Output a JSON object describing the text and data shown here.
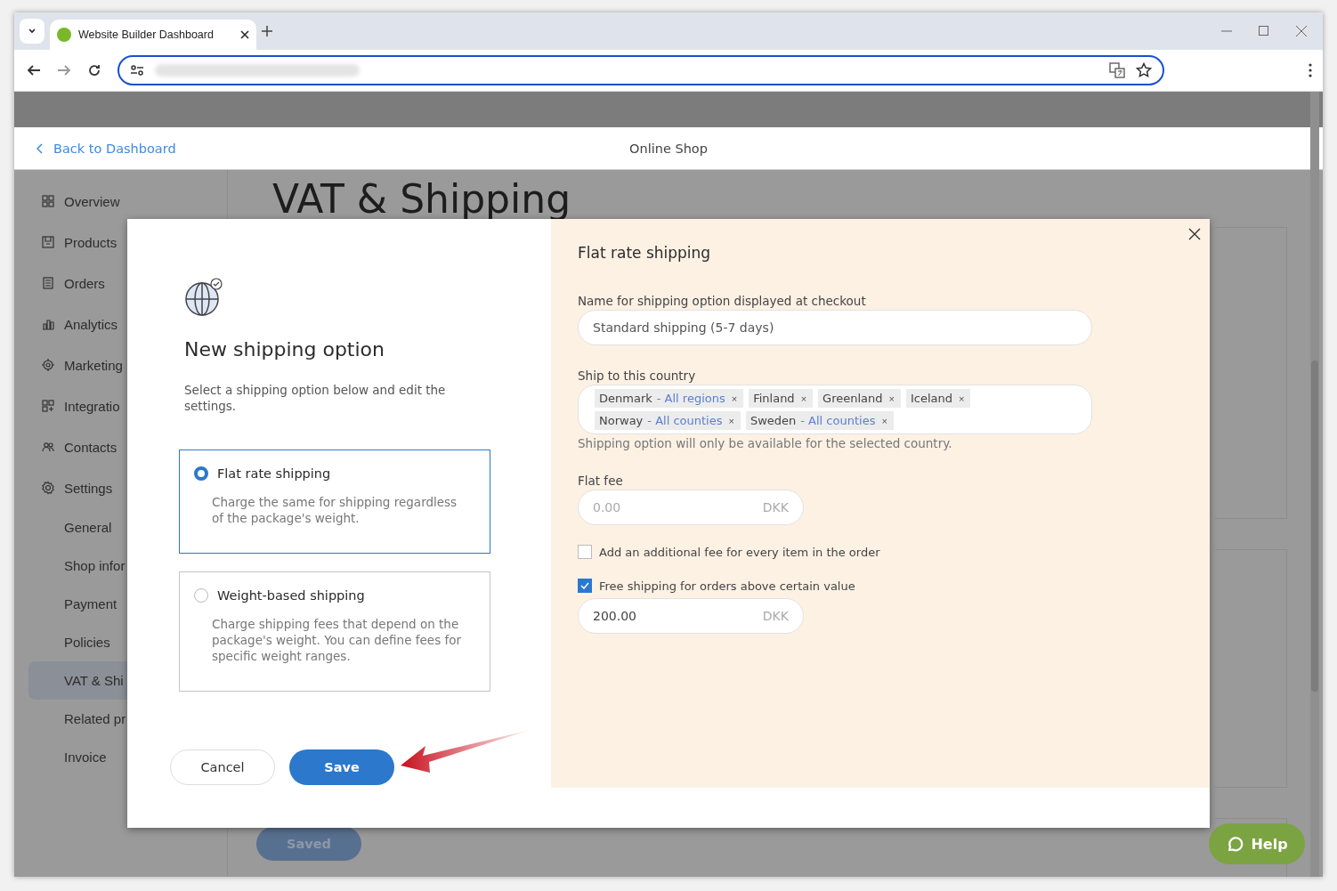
{
  "browser": {
    "tab_title": "Website Builder Dashboard"
  },
  "header": {
    "back_link": "Back to Dashboard",
    "title": "Online Shop"
  },
  "sidebar": {
    "items": [
      {
        "label": "Overview"
      },
      {
        "label": "Products"
      },
      {
        "label": "Orders"
      },
      {
        "label": "Analytics"
      },
      {
        "label": "Marketing"
      },
      {
        "label": "Integratio"
      },
      {
        "label": "Contacts"
      },
      {
        "label": "Settings",
        "children": [
          {
            "label": "General",
            "selected": false
          },
          {
            "label": "Shop infor",
            "selected": false
          },
          {
            "label": "Payment",
            "selected": false
          },
          {
            "label": "Policies",
            "selected": false
          },
          {
            "label": "VAT & Shi",
            "selected": true
          },
          {
            "label": "Related pr",
            "selected": false
          },
          {
            "label": "Invoice",
            "selected": false
          }
        ]
      }
    ]
  },
  "page_title": "VAT & Shipping",
  "saved_button": "Saved",
  "help_button": "Help",
  "modal": {
    "heading": "New shipping option",
    "description": "Select a shipping option below and edit the settings.",
    "options": [
      {
        "title": "Flat rate shipping",
        "description": "Charge the same for shipping regardless of the package's weight.",
        "selected": true
      },
      {
        "title": "Weight-based shipping",
        "description": "Charge shipping fees that depend on the package's weight. You can define fees for specific weight ranges.",
        "selected": false
      }
    ],
    "cancel_button": "Cancel",
    "save_button": "Save",
    "panel": {
      "title": "Flat rate shipping",
      "name_label": "Name for shipping option displayed at checkout",
      "name_value": "Standard shipping (5-7 days)",
      "country_label": "Ship to this country",
      "countries": [
        {
          "name": "Denmark",
          "scope": "- All regions",
          "remove": "×"
        },
        {
          "name": "Finland",
          "remove": "×"
        },
        {
          "name": "Greenland",
          "remove": "×"
        },
        {
          "name": "Iceland",
          "remove": "×"
        },
        {
          "name": "Norway",
          "scope": "- All counties",
          "remove": "×"
        },
        {
          "name": "Sweden",
          "scope": "- All counties",
          "remove": "×"
        }
      ],
      "country_hint": "Shipping option will only be available for the selected country.",
      "fee_label": "Flat fee",
      "fee_placeholder": "0.00",
      "fee_currency": "DKK",
      "additional_fee": {
        "label": "Add an additional fee for every item in the order",
        "checked": false
      },
      "free_shipping": {
        "label": "Free shipping for orders above certain value",
        "checked": true,
        "value": "200.00",
        "currency": "DKK"
      }
    }
  }
}
